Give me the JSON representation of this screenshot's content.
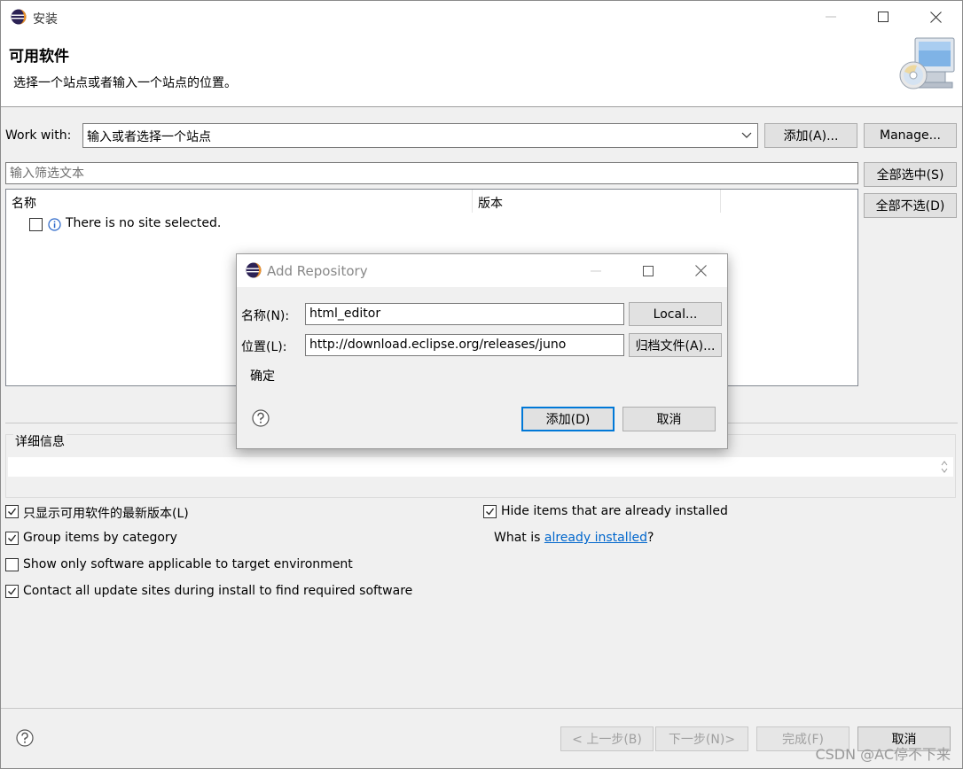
{
  "window": {
    "title": "安装",
    "controls": [
      "minimize-icon",
      "maximize-icon",
      "close-icon"
    ]
  },
  "header": {
    "title": "可用软件",
    "description": "选择一个站点或者输入一个站点的位置。",
    "icon": "install-software-icon"
  },
  "work_with": {
    "label": "Work with:",
    "value": "输入或者选择一个站点",
    "add_button": "添加(A)...",
    "manage_button": "Manage..."
  },
  "filter": {
    "placeholder": "输入筛选文本",
    "select_all_button": "全部选中(S)",
    "deselect_all_button": "全部不选(D)"
  },
  "tree": {
    "columns": [
      "名称",
      "版本"
    ],
    "rows": [
      {
        "checked": false,
        "icon": "info-icon",
        "label": "There is no site selected."
      }
    ]
  },
  "details": {
    "label": "详细信息",
    "value": ""
  },
  "options": {
    "show_latest": {
      "label": "只显示可用软件的最新版本(L)",
      "checked": true
    },
    "group_by_category": {
      "label": "Group items by category",
      "checked": true
    },
    "show_applicable": {
      "label": "Show only software applicable to target environment",
      "checked": false
    },
    "contact_all": {
      "label": "Contact all update sites during install to find required software",
      "checked": true
    },
    "hide_installed": {
      "label": "Hide items that are already installed",
      "checked": true
    },
    "what_is_prefix": "What is ",
    "what_is_link": "already installed",
    "what_is_suffix": "?"
  },
  "footer": {
    "back_button": "< 上一步(B)",
    "next_button": "下一步(N)>",
    "finish_button": "完成(F)",
    "cancel_button": "取消"
  },
  "dialog": {
    "title": "Add Repository",
    "name_label": "名称(N):",
    "name_value": "html_editor",
    "local_button": "Local...",
    "location_label": "位置(L):",
    "location_value": "http://download.eclipse.org/releases/juno",
    "archive_button": "归档文件(A)...",
    "message": "确定",
    "add_button": "添加(D)",
    "cancel_button": "取消"
  },
  "watermark": "CSDN @AC停不下来"
}
